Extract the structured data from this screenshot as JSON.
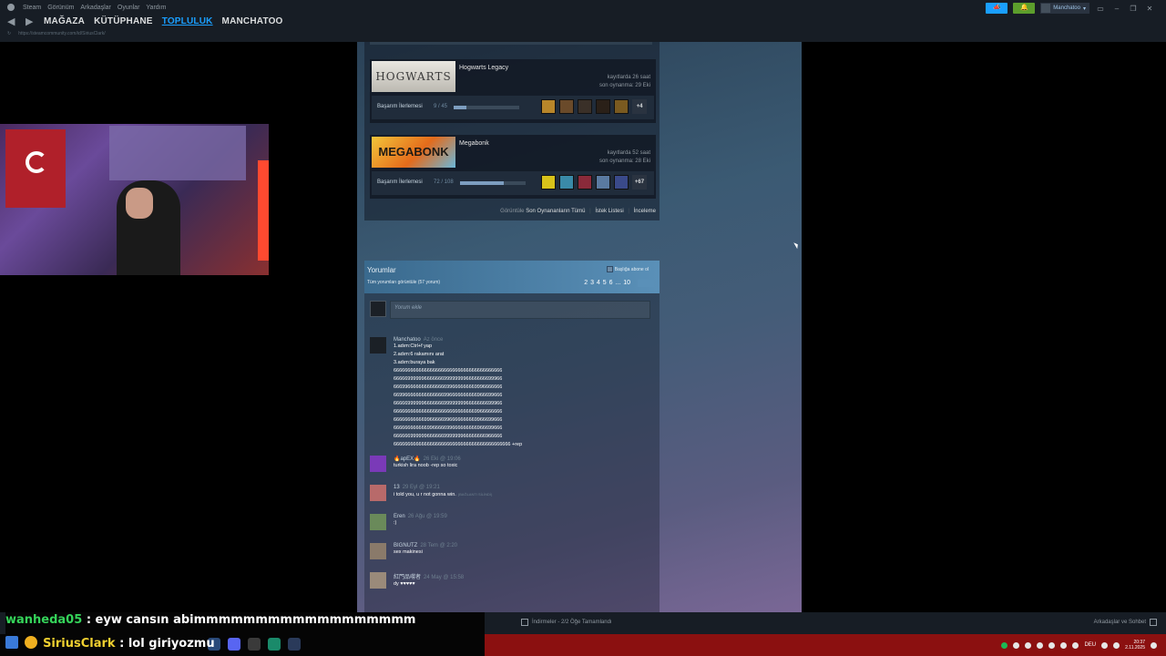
{
  "menu": [
    "Steam",
    "Görünüm",
    "Arkadaşlar",
    "Oyunlar",
    "Yardım"
  ],
  "nav": {
    "store": "MAĞAZA",
    "library": "KÜTÜPHANE",
    "community": "TOPLULUK",
    "user": "MANCHATOO"
  },
  "url": "https://steamcommunity.com/id/SiriusClark/",
  "account_name": "Manchatoo",
  "games": [
    {
      "title": "Hogwarts Legacy",
      "logo": "HOGWARTS",
      "hours": "kayıtlarda 26 saat",
      "last_played": "son oynanma: 29 Eki",
      "ach_label": "Başarım İlerlemesi",
      "ach_count": "9 / 45",
      "ach_progress": 0.2,
      "more": "+4",
      "icon_colors": [
        "#b8862a",
        "#6a4a2a",
        "#3a3028",
        "#2a2018",
        "#7a5a20"
      ]
    },
    {
      "title": "Megabonk",
      "logo": "MEGABONK",
      "hours": "kayıtlarda 52 saat",
      "last_played": "son oynanma: 28 Eki",
      "ach_label": "Başarım İlerlemesi",
      "ach_count": "72 / 108",
      "ach_progress": 0.67,
      "more": "+67",
      "icon_colors": [
        "#d8c21a",
        "#3a8aa8",
        "#8a2a3a",
        "#5a7aa0",
        "#3a4a8a"
      ]
    }
  ],
  "links": {
    "view": "Görüntüle",
    "recent": "Son Oynananların Tümü",
    "wishlist": "İstek Listesi",
    "review": "İnceleme"
  },
  "comments_section": {
    "title": "Yorumlar",
    "view_all": "Tüm yorumları görüntüle (57 yorum)",
    "subscribe": "Başlığa abone ol",
    "pages": "2 3 4 5 6 ... 10",
    "placeholder": "Yorum ekle"
  },
  "comments": [
    {
      "author": "Manchatoo",
      "date": "Az önce",
      "text": "1.adım:Ctrl+f yap\n2.adım:6 rakamını arat\n3.adım:buraya bak\n666666666666666666666666666666666666666\n666669999996666666999999996666666699966\n666996666666666666699666666669996666666\n669966666666666666996666666666966699666\n666669999996666666999999996666666699966\n666666666666666666666666666669966666666\n666666666669966666996666666669966699666\n666666666666996666699666666666966699666\n666666999999666666999999966666666966666\n666666666666666666666666666666666666666666 +rep",
      "avatar_color": "#1b2026"
    },
    {
      "author": "🔥apEX🔥",
      "date": "26 Eki @ 19:06",
      "text": "turkish lira noob -rep so toxic",
      "avatar_color": "#7a3ab8"
    },
    {
      "author": "13",
      "date": "29 Eyl @ 19:21",
      "text": "i told you, u r not gonna win.",
      "extra": "(BAĞLANTI SİLİNDİ)",
      "avatar_color": "#b86a6a"
    },
    {
      "author": "Eren",
      "date": "26 Ağu @ 19:59",
      "text": ":)",
      "avatar_color": "#6a8a5a"
    },
    {
      "author": "BIGNUTZ",
      "date": "28 Tem @ 2:20",
      "text": "sex makinesi",
      "avatar_color": "#8a7a6a"
    },
    {
      "author": "紅門品嚐者",
      "date": "24 May @ 15:58",
      "text": "dy ♥♥♥♥♥",
      "avatar_color": "#9a8a7a"
    }
  ],
  "bottom": {
    "downloads": "İndirmeler - 2/2 Öğe Tamamlandı",
    "friends": "Arkadaşlar ve Sohbet"
  },
  "chat": [
    {
      "user": "wanheda05",
      "message": ": eyw cansın abimmmmmmmmmmmmmmmmmm"
    },
    {
      "user": "SiriusClark",
      "message": ": lol giriyozmu"
    }
  ],
  "tray": {
    "lang": "DEU",
    "time": "20:37",
    "date": "2.11.2025"
  },
  "colors": {
    "accent": "#1a9fff",
    "taskbar": "#8b1010",
    "chat_user1": "#35d45a",
    "chat_user2": "#f0d030"
  }
}
